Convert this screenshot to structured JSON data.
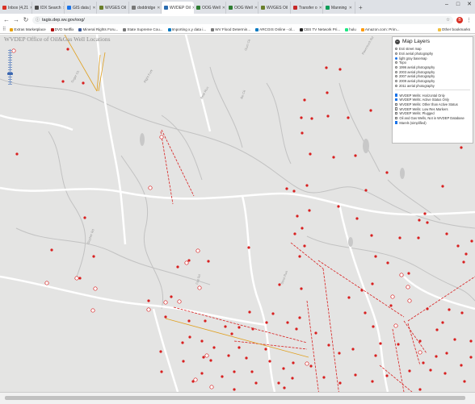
{
  "browser": {
    "tabs": [
      {
        "title": "Inbox (4,21",
        "color": "#d93025"
      },
      {
        "title": "IDX Search",
        "color": "#4a4a4a"
      },
      {
        "title": "GIS data |",
        "color": "#1a73e8"
      },
      {
        "title": "WVGES Oil",
        "color": "#6a7f2a"
      },
      {
        "title": "doddridge",
        "color": "#777777"
      },
      {
        "title": "WVDEP Oil",
        "color": "#2b6cb0",
        "active": true
      },
      {
        "title": "OOG Well",
        "color": "#2e7d32"
      },
      {
        "title": "OOG Well",
        "color": "#2e7d32"
      },
      {
        "title": "WVGES Oil",
        "color": "#6a7f2a"
      },
      {
        "title": "Transfer o",
        "color": "#c62828"
      },
      {
        "title": "Manning",
        "color": "#0f9d58"
      }
    ],
    "url": "tagis.dep.wv.gov/oog/",
    "avatar_letter": "B",
    "bookmarks": [
      {
        "label": "Extras Marketplace",
        "color": "#e8a000"
      },
      {
        "label": "DVD Netflix",
        "color": "#b00000"
      },
      {
        "label": "Mineral Rights Foru...",
        "color": "#3b5998"
      },
      {
        "label": "State Supreme Cou...",
        "color": "#777777"
      },
      {
        "label": "Importing x,y data i...",
        "color": "#0079c1"
      },
      {
        "label": "WV Flood Determin...",
        "color": "#777777"
      },
      {
        "label": "ARCGIS Online - ol...",
        "color": "#0079c1"
      },
      {
        "label": "CBS TV Network Pri...",
        "color": "#222222"
      },
      {
        "label": "hulu",
        "color": "#1ce783"
      },
      {
        "label": "Amazon.com: Prim...",
        "color": "#ff9900"
      }
    ],
    "other_bookmarks": "Other bookmarks"
  },
  "map": {
    "title": "WVDEP Office of Oil&Gas Well Locations",
    "layers_title": "Map Layers",
    "basemaps": [
      {
        "label": "Esri street map",
        "selected": false
      },
      {
        "label": "Esri aerial photography",
        "selected": false
      },
      {
        "label": "light gray basemap",
        "selected": true
      },
      {
        "label": "Topo",
        "selected": false
      },
      {
        "label": "1996 aerial photography",
        "selected": false
      },
      {
        "label": "2003 aerial photography",
        "selected": false
      },
      {
        "label": "2007 aerial photography",
        "selected": false
      },
      {
        "label": "2009 aerial photography",
        "selected": false
      },
      {
        "label": "2011 aerial photography",
        "selected": false
      }
    ],
    "overlays": [
      {
        "label": "WVDEP Wells: Horizontal Only",
        "checked": true
      },
      {
        "label": "WVDEP Wells: Active Status Only",
        "checked": true
      },
      {
        "label": "WVDEP Wells: Other than Active Status",
        "checked": false
      },
      {
        "label": "WVDEP Wells: Low Res Markers",
        "checked": false
      },
      {
        "label": "WVDEP Wells: Plugged",
        "checked": false
      },
      {
        "label": "Oil and Gas Wells, Not in WVDEP Database",
        "checked": false
      },
      {
        "label": "Marels (simplified)",
        "checked": true
      }
    ],
    "colors": {
      "well": "#d81f1f",
      "lateral": "#d81f1f",
      "lateral_other": "#e0a020",
      "road": "#ffffff",
      "creek": "#c2c2c2",
      "background": "#e4e4e3"
    }
  }
}
